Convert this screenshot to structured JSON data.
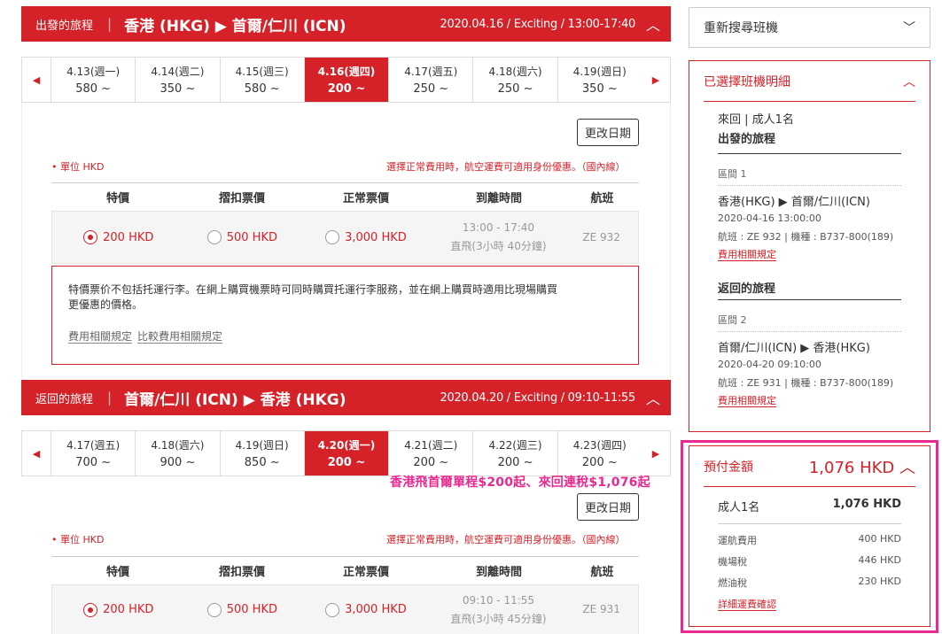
{
  "outbound": {
    "label": "出發的旅程",
    "route": "香港 (HKG)  ▶  首爾/仁川 (ICN)",
    "info": "2020.04.16 / Exciting / 13:00-17:40",
    "dates": [
      {
        "d": "4.13(週一)",
        "p": "580 ~"
      },
      {
        "d": "4.14(週二)",
        "p": "350 ~"
      },
      {
        "d": "4.15(週三)",
        "p": "580 ~"
      },
      {
        "d": "4.16(週四)",
        "p": "200 ~"
      },
      {
        "d": "4.17(週五)",
        "p": "250 ~"
      },
      {
        "d": "4.18(週六)",
        "p": "250 ~"
      },
      {
        "d": "4.19(週日)",
        "p": "350 ~"
      }
    ],
    "change_date": "更改日期",
    "unit": "• 單位 HKD",
    "note": "選擇正常費用時，航空運費可適用身份優惠。（國內線）",
    "headers": [
      "特價",
      "摺扣票價",
      "正常票價",
      "到離時間",
      "航班"
    ],
    "fares": [
      "200 HKD",
      "500 HKD",
      "3,000 HKD"
    ],
    "time": "13:00 - 17:40",
    "duration": "直飛(3小時 40分鐘)",
    "flight": "ZE 932",
    "notice": "特價票价不包括托運行李。在網上購買機票時可同時購買托運行李服務，並在網上購買時適用比現場購買更優惠的價格。",
    "link1": "費用相關規定",
    "link2": "比較費用相關規定"
  },
  "inbound": {
    "label": "返回的旅程",
    "route": "首爾/仁川 (ICN)  ▶  香港 (HKG)",
    "info": "2020.04.20 / Exciting / 09:10-11:55",
    "dates": [
      {
        "d": "4.17(週五)",
        "p": "700 ~"
      },
      {
        "d": "4.18(週六)",
        "p": "900 ~"
      },
      {
        "d": "4.19(週日)",
        "p": "850 ~"
      },
      {
        "d": "4.20(週一)",
        "p": "200 ~"
      },
      {
        "d": "4.21(週二)",
        "p": "200 ~"
      },
      {
        "d": "4.22(週三)",
        "p": "200 ~"
      },
      {
        "d": "4.23(週四)",
        "p": "200 ~"
      }
    ],
    "change_date": "更改日期",
    "unit": "• 單位 HKD",
    "note": "選擇正常費用時，航空運費可適用身份優惠。（國內線）",
    "headers": [
      "特價",
      "摺扣票價",
      "正常票價",
      "到離時間",
      "航班"
    ],
    "fares": [
      "200 HKD",
      "500 HKD",
      "3,000 HKD"
    ],
    "time": "09:10 - 11:55",
    "duration": "直飛(3小時 45分鐘)",
    "flight": "ZE 931"
  },
  "promo": "香港飛首爾單程$200起、來回連稅$1,076起",
  "sidebar": {
    "research": "重新搜尋班機",
    "selected_title": "已選擇班機明細",
    "trip_type": "來回   |   成人1名",
    "out_title": "出發的旅程",
    "out_seg": "區間 1",
    "out_route": "香港(HKG)  ▶  首爾/仁川(ICN)",
    "out_dt": "2020-04-16 13:00:00",
    "out_flight": "航班 : ZE 932  |  機種 : B737-800(189)",
    "out_link": "費用相關規定",
    "ret_title": "返回的旅程",
    "ret_seg": "區間 2",
    "ret_route": "首爾/仁川(ICN)  ▶  香港(HKG)",
    "ret_dt": "2020-04-20 09:10:00",
    "ret_flight": "航班 : ZE 931  |  機種 : B737-800(189)",
    "ret_link": "費用相關規定",
    "pay_title": "預付金額",
    "pay_total": "1,076 HKD",
    "adult_label": "成人1名",
    "adult_amount": "1,076 HKD",
    "items": [
      {
        "k": "運航費用",
        "v": "400 HKD"
      },
      {
        "k": "機場稅",
        "v": "446 HKD"
      },
      {
        "k": "燃油稅",
        "v": "230 HKD"
      }
    ],
    "detail_link": "詳細運費確認"
  }
}
